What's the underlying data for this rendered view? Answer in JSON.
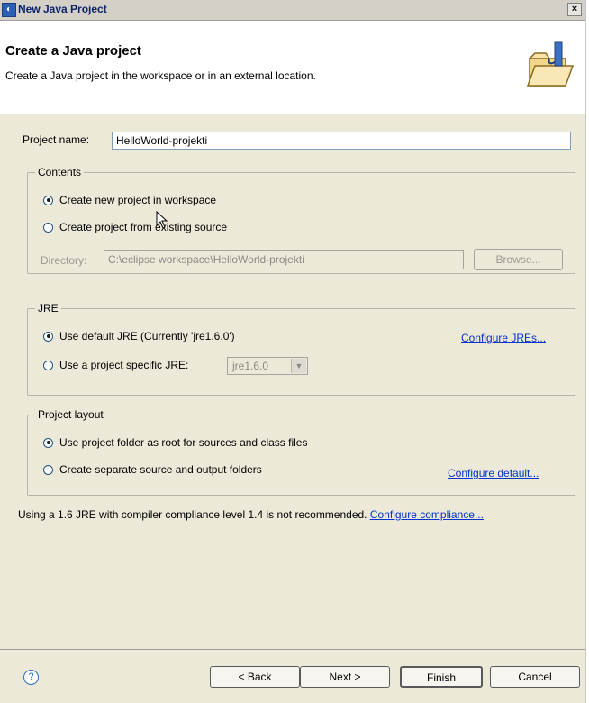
{
  "window": {
    "title": "New Java Project",
    "close_glyph": "×"
  },
  "banner": {
    "title": "Create a Java project",
    "description": "Create a Java project in the workspace or in an external location."
  },
  "project_name": {
    "label": "Project name:",
    "value": "HelloWorld-projekti"
  },
  "contents": {
    "label": "Contents",
    "option_new": "Create new project in workspace",
    "option_existing": "Create project from existing source",
    "directory_label": "Directory:",
    "directory_value": "C:\\eclipse workspace\\HelloWorld-projekti",
    "browse_label": "Browse..."
  },
  "jre": {
    "label": "JRE",
    "option_default": "Use default JRE (Currently 'jre1.6.0')",
    "configure_link": "Configure JREs...",
    "option_specific": "Use a project specific JRE:",
    "specific_value": "jre1.6.0"
  },
  "layout": {
    "label": "Project layout",
    "option_root": "Use project folder as root for sources and class files",
    "option_separate": "Create separate source and output folders",
    "configure_link": "Configure default..."
  },
  "notice": {
    "text": "Using a 1.6 JRE with compiler compliance level 1.4 is not recommended.",
    "link": "Configure compliance..."
  },
  "footer": {
    "help_glyph": "?",
    "back": "< Back",
    "next": "Next >",
    "finish": "Finish",
    "cancel": "Cancel"
  },
  "icons": {
    "window_icon": "eclipse-icon",
    "banner_icon": "java-project-folder-icon",
    "help_icon": "help-icon"
  }
}
